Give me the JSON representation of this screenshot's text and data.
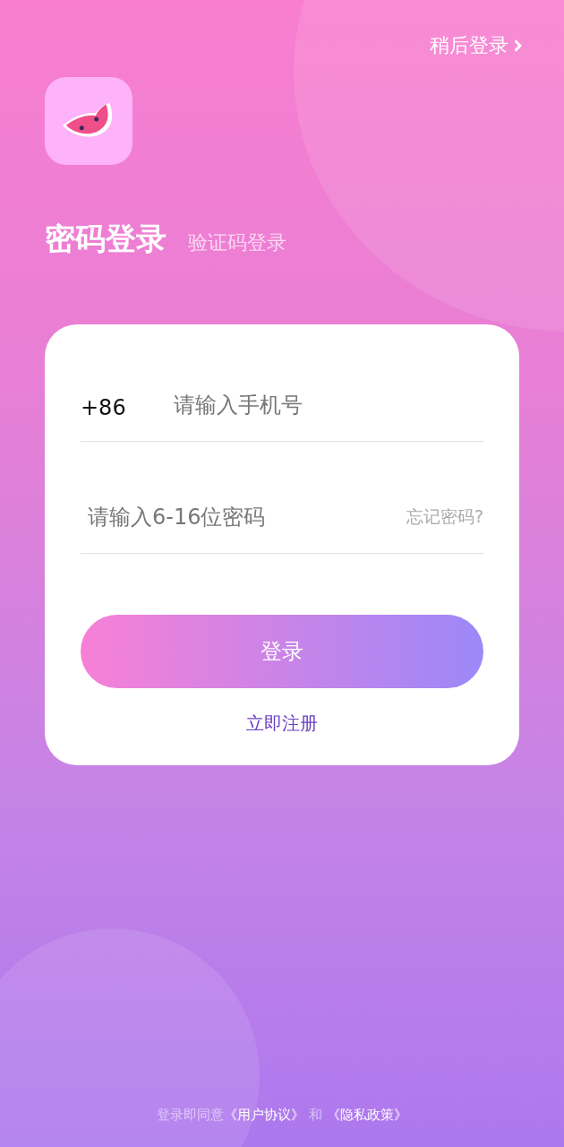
{
  "skip_link": {
    "label": "稍后登录"
  },
  "login_tabs": [
    {
      "label": "密码登录",
      "selected": true
    },
    {
      "label": "验证码登录",
      "selected": false
    }
  ],
  "form": {
    "country_code": "+86",
    "phone_placeholder": "请输入手机号",
    "password_placeholder": "请输入6-16位密码",
    "forgot_password": "忘记密码?",
    "submit": "登录",
    "register": "立即注册"
  },
  "agreement": {
    "prefix": "登录即同意",
    "user_agreement": "《用户协议》",
    "joiner": "和",
    "privacy_policy": "《隐私政策》"
  }
}
